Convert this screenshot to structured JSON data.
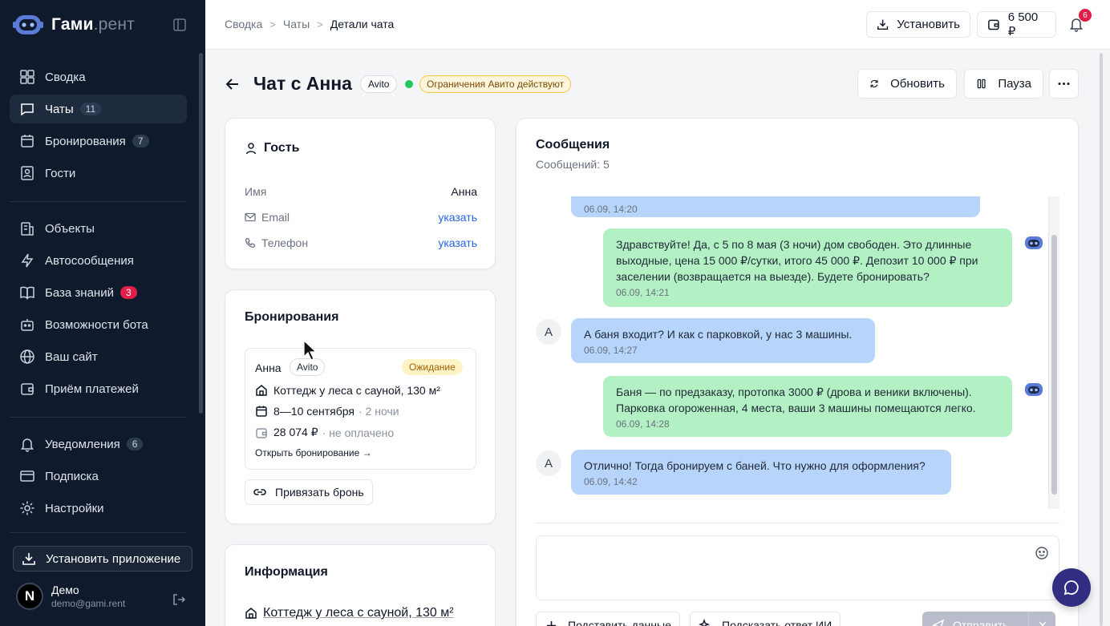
{
  "brand": {
    "name": "Гами",
    "domain": ".рент"
  },
  "sidebar": {
    "items": [
      {
        "label": "Сводка",
        "icon": "dashboard-icon"
      },
      {
        "label": "Чаты",
        "icon": "chat-icon",
        "badge": "11"
      },
      {
        "label": "Бронирования",
        "icon": "calendar-icon",
        "badge": "7"
      },
      {
        "label": "Гости",
        "icon": "guests-icon"
      }
    ],
    "items2": [
      {
        "label": "Объекты",
        "icon": "building-icon"
      },
      {
        "label": "Автосообщения",
        "icon": "lightning-icon"
      },
      {
        "label": "База знаний",
        "icon": "book-icon",
        "badge": "3"
      },
      {
        "label": "Возможности бота",
        "icon": "robot-icon"
      },
      {
        "label": "Ваш сайт",
        "icon": "globe-icon"
      },
      {
        "label": "Приём платежей",
        "icon": "wallet-icon"
      }
    ],
    "items3": [
      {
        "label": "Уведомления",
        "icon": "bell-icon",
        "badge": "6"
      },
      {
        "label": "Подписка",
        "icon": "card-icon"
      },
      {
        "label": "Настройки",
        "icon": "gear-icon"
      }
    ],
    "install_label": "Установить приложение",
    "user": {
      "initial": "N",
      "name": "Демо",
      "email": "demo@gami.rent"
    }
  },
  "topbar": {
    "breadcrumbs": [
      "Сводка",
      "Чаты",
      "Детали чата"
    ],
    "install_label": "Установить",
    "balance": "6 500 ₽",
    "notif_count": "6"
  },
  "page": {
    "title": "Чат с Анна",
    "source_tag": "Avito",
    "warning": "Ограничения Авито действуют",
    "refresh_label": "Обновить",
    "pause_label": "Пауза"
  },
  "guest": {
    "title": "Гость",
    "name_label": "Имя",
    "name_value": "Анна",
    "email_label": "Email",
    "email_action": "указать",
    "phone_label": "Телефон",
    "phone_action": "указать"
  },
  "bookings": {
    "title": "Бронирования",
    "item": {
      "guest": "Анна",
      "source": "Avito",
      "status": "Ожидание",
      "property": "Коттедж у леса с сауной, 130 м²",
      "dates": "8—10 сентября",
      "nights": "· 2 ночи",
      "amount": "28 074 ₽",
      "payment": "· не оплачено",
      "open_link": "Открыть бронирование →"
    },
    "bind_label": "Привязать бронь"
  },
  "info": {
    "title": "Информация",
    "property_link": "Коттедж у леса с сауной, 130 м²"
  },
  "messages": {
    "title": "Сообщения",
    "count_text": "Сообщений: 5",
    "list": [
      {
        "dir": "in",
        "text": "",
        "time": "06.09, 14:20"
      },
      {
        "dir": "out",
        "text": "Здравствуйте! Да, с 5 по 8 мая (3 ночи) дом свободен. Это длинные выходные, цена 15 000 ₽/сутки, итого 45 000 ₽. Депозит 10 000 ₽ при заселении (возвращается на выезде). Будете бронировать?",
        "time": "06.09, 14:21"
      },
      {
        "dir": "in",
        "text": "А баня входит? И как с парковкой, у нас 3 машины.",
        "time": "06.09, 14:27",
        "avatar": "А"
      },
      {
        "dir": "out",
        "text": "Баня — по предзаказу, протопка 3000 ₽ (дрова и веники включены). Парковка огороженная, 4 места, ваши 3 машины помещаются легко.",
        "time": "06.09, 14:28"
      },
      {
        "dir": "in",
        "text": "Отлично! Тогда бронируем с баней. Что нужно для оформления?",
        "time": "06.09, 14:42",
        "avatar": "А"
      }
    ],
    "fill_data_label": "Подставить данные",
    "ai_suggest_label": "Подсказать ответ ИИ",
    "send_label": "Отправить"
  },
  "colors": {
    "sidebar_bg": "#0f1b2d",
    "incoming_bubble": "#b7d4fb",
    "outgoing_bubble": "#b3f0c4",
    "accent_link": "#2563eb",
    "badge_red": "#e11d48"
  }
}
